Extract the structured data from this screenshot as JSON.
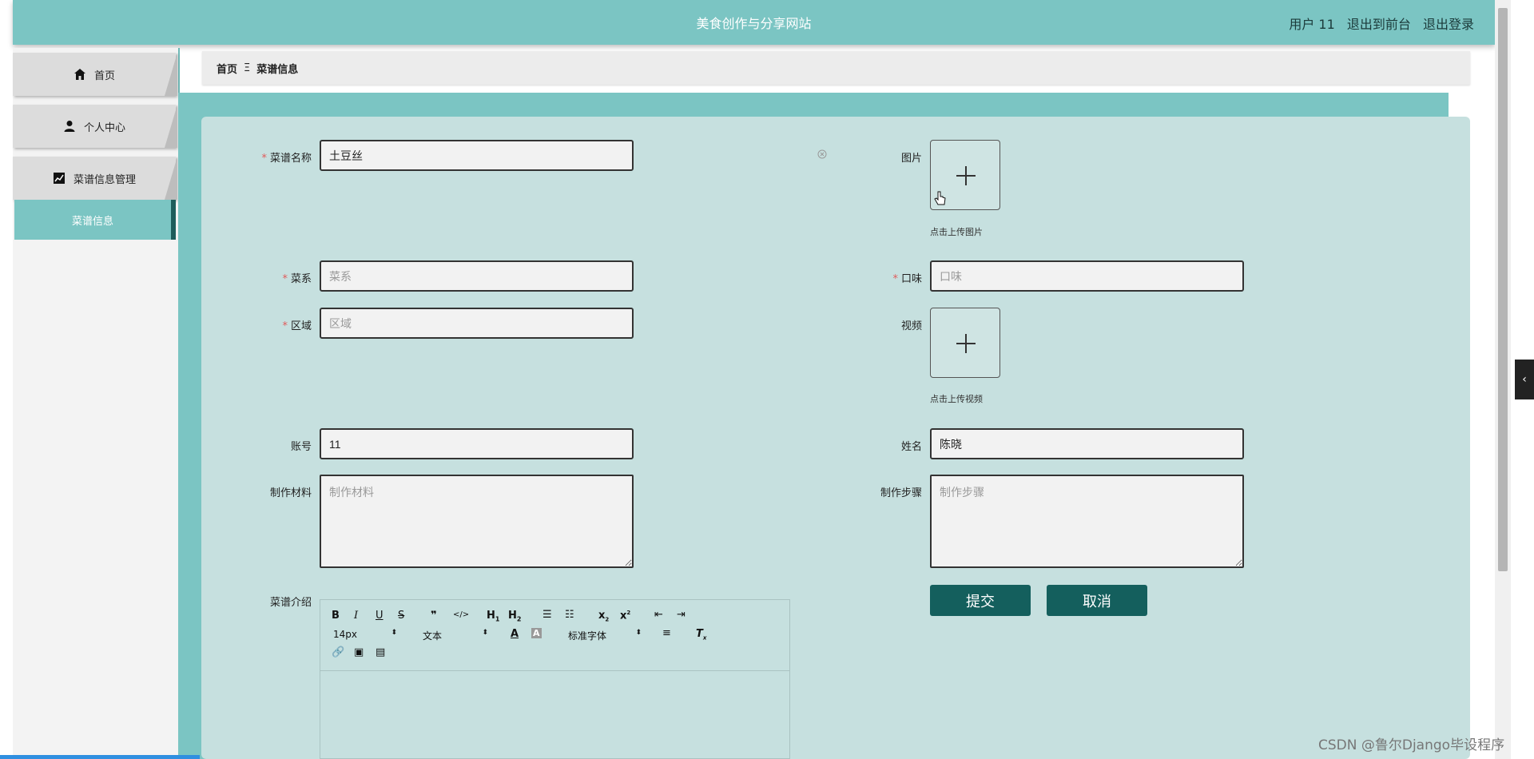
{
  "header": {
    "title": "美食创作与分享网站",
    "user": "用户 11",
    "to_front": "退出到前台",
    "logout": "退出登录"
  },
  "sidebar": {
    "items": [
      {
        "label": "首页",
        "icon": "home-icon"
      },
      {
        "label": "个人中心",
        "icon": "user-icon"
      },
      {
        "label": "菜谱信息管理",
        "icon": "chart-icon"
      }
    ],
    "sub_item": "菜谱信息"
  },
  "breadcrumb": {
    "home": "首页",
    "separator": "Ξ",
    "current": "菜谱信息"
  },
  "form": {
    "name": {
      "label": "菜谱名称",
      "value": "土豆丝"
    },
    "image": {
      "label": "图片",
      "hint": "点击上传图片"
    },
    "cuisine": {
      "label": "菜系",
      "placeholder": "菜系"
    },
    "taste": {
      "label": "口味",
      "placeholder": "口味"
    },
    "region": {
      "label": "区域",
      "placeholder": "区域"
    },
    "video": {
      "label": "视频",
      "hint": "点击上传视频"
    },
    "account": {
      "label": "账号",
      "value": "11"
    },
    "realname": {
      "label": "姓名",
      "value": "陈晓"
    },
    "materials": {
      "label": "制作材料",
      "placeholder": "制作材料"
    },
    "steps": {
      "label": "制作步骤",
      "placeholder": "制作步骤"
    },
    "intro": {
      "label": "菜谱介绍"
    },
    "submit": "提交",
    "cancel": "取消"
  },
  "editor": {
    "font_size": "14px",
    "text_type": "文本",
    "font_family": "标准字体"
  },
  "watermark": "CSDN @鲁尔Django毕设程序"
}
